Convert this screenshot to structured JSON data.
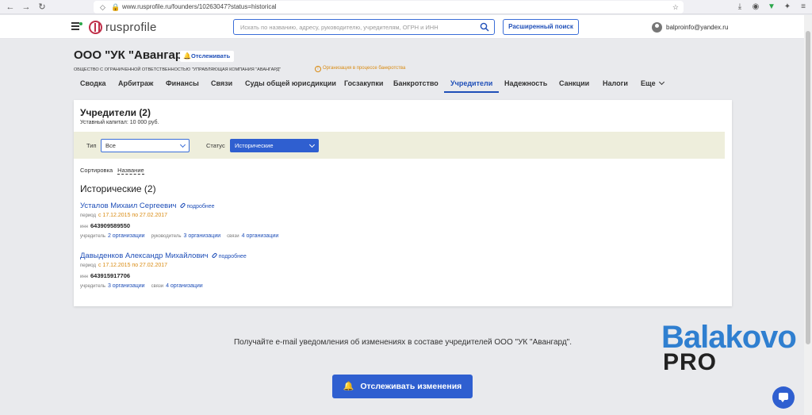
{
  "browser": {
    "url": "www.rusprofile.ru/founders/10263047?status=historical"
  },
  "header": {
    "logo_text": "rusprofile",
    "search_placeholder": "Искать по названию, адресу, руководителю, учредителям, ОГРН и ИНН",
    "advanced_search": "Расширенный поиск",
    "user_email": "balproinfo@yandex.ru"
  },
  "company": {
    "title": "ООО \"УК \"Авангард\"",
    "track_label": "Отслеживать",
    "full_name": "ОБЩЕСТВО С ОГРАНИЧЕННОЙ ОТВЕТСТВЕННОСТЬЮ \"УПРАВЛЯЮЩАЯ КОМПАНИЯ \"АВАНГАРД\"",
    "bankruptcy_notice": "Организация в процессе банкротства"
  },
  "tabs": [
    {
      "label": "Сводка"
    },
    {
      "label": "Арбитраж"
    },
    {
      "label": "Финансы"
    },
    {
      "label": "Связи"
    },
    {
      "label": "Суды общей юрисдикции"
    },
    {
      "label": "Госзакупки"
    },
    {
      "label": "Банкротство"
    },
    {
      "label": "Учредители"
    },
    {
      "label": "Надежность"
    },
    {
      "label": "Санкции"
    },
    {
      "label": "Налоги"
    },
    {
      "label": "Еще"
    }
  ],
  "founders": {
    "title": "Учредители (2)",
    "capital": "Уставный капитал: 10 000 руб.",
    "filter_type_label": "Тип",
    "filter_type_value": "Все",
    "filter_status_label": "Статус",
    "filter_status_value": "Исторические",
    "sort_label": "Сортировка",
    "sort_value": "Название",
    "section_title": "Исторические (2)",
    "more_label": "подробнее",
    "period_label": "период",
    "inn_label": "инн",
    "founder_label": "учредитель",
    "director_label": "руководитель",
    "links_label": "связи",
    "people": [
      {
        "name": "Усталов Михаил Сергеевич",
        "period": "с 17.12.2015 по 27.02.2017",
        "inn": "643909589550",
        "founder_orgs": "2 организации",
        "director_orgs": "3 организации",
        "links_orgs": "4 организации"
      },
      {
        "name": "Давыденков Александр Михайлович",
        "period": "с 17.12.2015 по 27.02.2017",
        "inn": "643915917706",
        "founder_orgs": "3 организации",
        "links_orgs": "4 организации"
      }
    ]
  },
  "notify": {
    "text": "Получайте e-mail уведомления об изменениях в составе учредителей ООО \"УК \"Авангард\".",
    "button": "Отслеживать изменения"
  },
  "watermark": {
    "line1": "Balakovo",
    "line2": "PRO"
  },
  "colors": {
    "accent": "#1f4fb8",
    "button": "#2f5fd0",
    "period": "#d98b12",
    "filter_bg": "#eeeedc"
  }
}
